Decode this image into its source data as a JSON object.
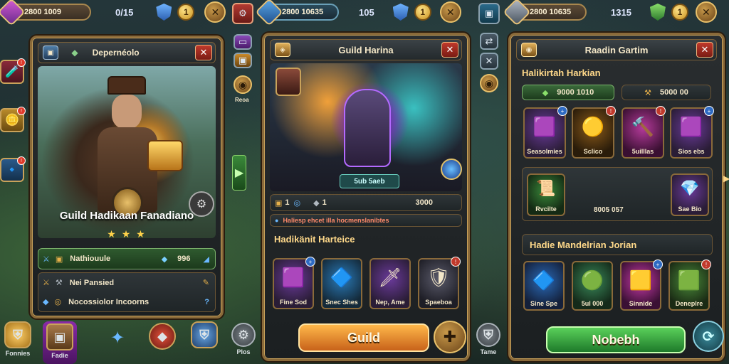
{
  "panel1": {
    "topbar": {
      "resource": "2800 1009",
      "count": "0/15",
      "coin": "1",
      "close": "✕"
    },
    "title": "Depernéolo",
    "hero_name": "Guild Hadikaan Fanadiano",
    "stars": "★ ★ ★",
    "row1": {
      "label": "Nathiouule",
      "value": "996"
    },
    "row2": {
      "label": "Nei Pansied"
    },
    "row3": {
      "label": "Nocossiolor Incoorns"
    },
    "nav": [
      {
        "label": "Fonnies",
        "icon": "shield"
      },
      {
        "label": "Fadie",
        "icon": "chest"
      },
      {
        "label": "",
        "icon": "feather"
      },
      {
        "label": "",
        "icon": "gem"
      },
      {
        "label": "",
        "icon": "shield"
      }
    ]
  },
  "panel2": {
    "topbar": {
      "resource": "2800 10635",
      "count": "105",
      "coin": "1",
      "close": "✕"
    },
    "title": "Guild Harina",
    "badge": "5ub 5aeb",
    "stats": {
      "a": "1",
      "b": "1",
      "c": "3000"
    },
    "info_line": "Haliesp ehcet illa hocmenslanibtes",
    "section": "Hadikänit Harteice",
    "items": [
      {
        "label": "Fine Sod",
        "glyph": "🟪"
      },
      {
        "label": "Snec Shes",
        "glyph": "🔷"
      },
      {
        "label": "Nep, Ame",
        "glyph": "🗡"
      },
      {
        "label": "Spaeboa",
        "glyph": "🛡"
      }
    ],
    "guild_button": "Guild",
    "side_label": "Reoa",
    "bottom_label": "Plos"
  },
  "panel3": {
    "topbar": {
      "resource": "2800 10635",
      "count": "1315",
      "coin": "1",
      "close": "✕"
    },
    "title": "Raadin Gartim",
    "subtitle": "Halikirtah Harkian",
    "pill1": "9000 1010",
    "pill2": "5000 00",
    "items_row1": [
      {
        "label": "Seasolmies",
        "glyph": "🟪"
      },
      {
        "label": "Sclico",
        "glyph": "🟡"
      },
      {
        "label": "5uilllas",
        "glyph": "🔨"
      },
      {
        "label": "Sios ebs",
        "glyph": "🟪"
      }
    ],
    "feature": {
      "left": "Rvcilte",
      "mid": "8005 057",
      "right": "Sae Bio"
    },
    "section": "Hadie Mandelrian Jorian",
    "items_row2": [
      {
        "label": "Sine Spe",
        "glyph": "🔷"
      },
      {
        "label": "5ul 000",
        "glyph": "🟢"
      },
      {
        "label": "Sinnide",
        "glyph": "🟨"
      },
      {
        "label": "Deneplre",
        "glyph": "🟩"
      }
    ],
    "action_button": "Nobebh",
    "bottom_label": "Tame"
  }
}
